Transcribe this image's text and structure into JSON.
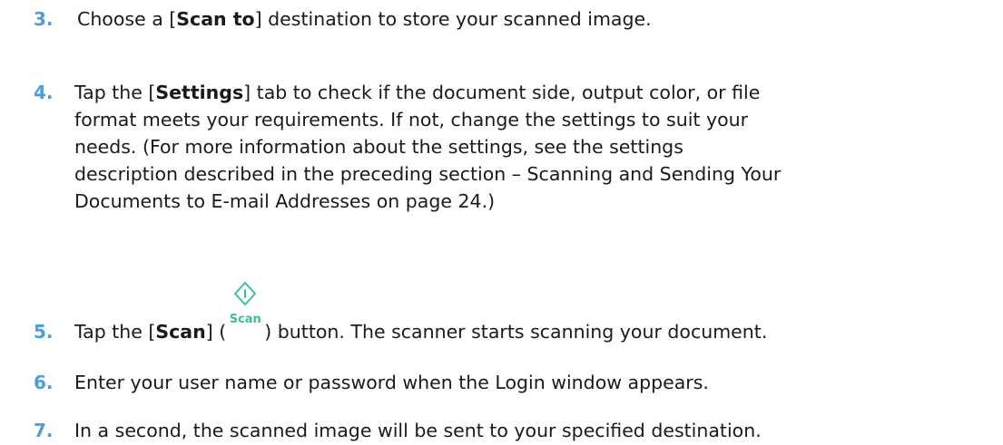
{
  "steps": [
    {
      "number": "3.",
      "pre": "Choose a [",
      "bold": "Scan to",
      "post": "] destination to store your scanned image."
    },
    {
      "number": "4.",
      "line1_pre": "Tap the [",
      "line1_bold": "Settings",
      "line1_post": "] tab to check if the document side, output color, or file",
      "line2": "format meets your requirements.   If not, change the settings to suit your",
      "line3": "needs.   (For more information about the settings, see the settings",
      "line4": "description described in the preceding section – Scanning and Sending Your",
      "line5": "Documents to E-mail Addresses on page 24.)"
    },
    {
      "number": "5.",
      "pre": "Tap the [",
      "bold": "Scan",
      "mid": "] (",
      "icon_label": "Scan",
      "icon_name": "scan-start-icon",
      "post": ") button. The scanner starts scanning your document.",
      "icon_color": "#3bbf95"
    },
    {
      "number": "6.",
      "text": "Enter your user name or password when the Login window appears."
    },
    {
      "number": "7.",
      "text": "In a second, the scanned image will be sent to your specified destination."
    }
  ],
  "colors": {
    "step_number": "#4a9ee0",
    "text": "#1a1a1a",
    "scan_icon": "#3bbf95"
  }
}
